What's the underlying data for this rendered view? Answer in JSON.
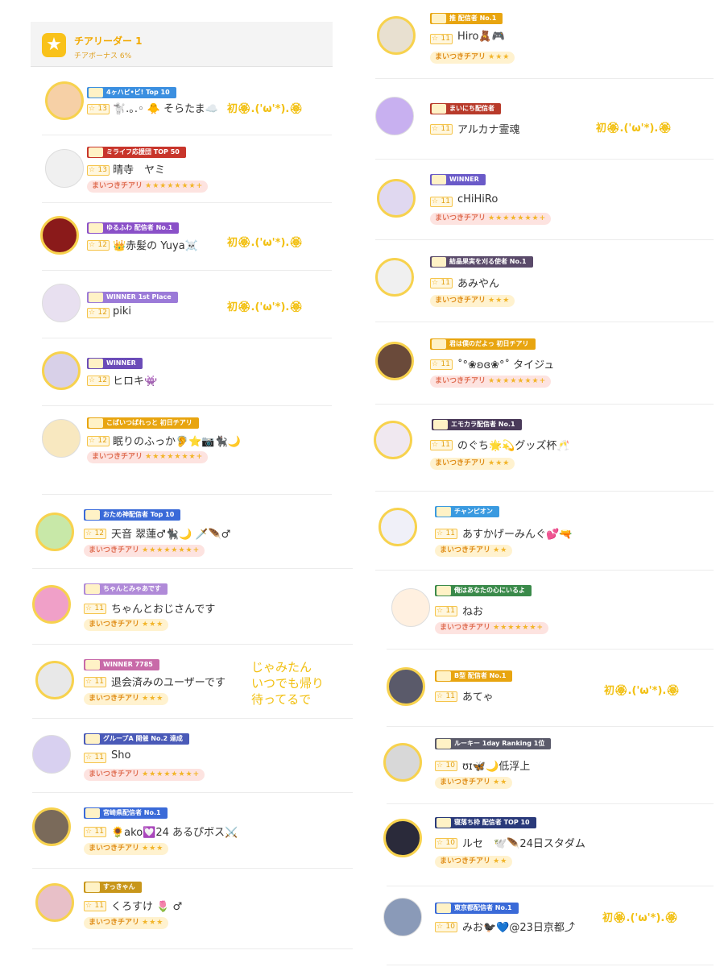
{
  "header": {
    "title": "チアリーダー 1",
    "subtitle": "チアボーナス 6%"
  },
  "badge_labels": {
    "maitsuki": "まいつきチアリ",
    "mainichi": "まいにち配信者",
    "winner": "WINNER"
  },
  "left_rows": [
    {
      "level": "13",
      "name": "🐩.｡.◦ 🐥 そらたま☁️",
      "ribbon": "4ヶハピ•ビ! Top 10",
      "ribbon_color": "#3b8fe0",
      "cheer": null,
      "comment": "初🏵.('ω'*).🏵"
    },
    {
      "level": "13",
      "name": "晴寺　ヤミ",
      "ribbon": "ミライフ応援団 TOP 50",
      "ribbon_color": "#c8352b",
      "cheer": "pink",
      "cheer_stars": "★★★★★★★+",
      "comment": null
    },
    {
      "level": "12",
      "name": "👑赤髪の Yuya☠️",
      "ribbon": "ゆるふわ 配信者 No.1",
      "ribbon_color": "#8a50c8",
      "cheer": null,
      "comment": "初🏵.('ω'*).🏵"
    },
    {
      "level": "12",
      "name": "piki",
      "ribbon": "WINNER 1st Place",
      "ribbon_color": "#9b7ad8",
      "cheer": null,
      "comment": "初🏵.('ω'*).🏵"
    },
    {
      "level": "12",
      "name": "ヒロキ👾",
      "ribbon": "WINNER",
      "ribbon_color": "#6b4cb8",
      "cheer": null,
      "comment": null
    },
    {
      "level": "12",
      "name": "眠りのふっか🦻⭐📷🐈‍⬛🌙",
      "ribbon": "こばいつばれっと 初日チアリ",
      "ribbon_color": "#e8a510",
      "cheer": "pink",
      "cheer_stars": "★★★★★★★+",
      "comment": null
    },
    {
      "level": "12",
      "name": "天音 翠蓮♂🐈‍⬛🌙 🗡️🪶♂",
      "ribbon": "おため神配信者 Top 10",
      "ribbon_color": "#3a6ad8",
      "cheer": "pink",
      "cheer_stars": "★★★★★★★+",
      "comment": null
    },
    {
      "level": "11",
      "name": "ちゃんとおじさんです",
      "ribbon": "ちゃんとみゃあです",
      "ribbon_color": "#b08ad8",
      "cheer": "yellow",
      "cheer_stars": "★★★",
      "comment": null
    },
    {
      "level": "11",
      "name": "退会済みのユーザーです",
      "ribbon": "WINNER 7785",
      "ribbon_color": "#c86aa8",
      "cheer": "yellow",
      "cheer_stars": "★★★",
      "comment": "じゃみたん\nいつでも帰り\n待ってるで"
    },
    {
      "level": "11",
      "name": "Sho",
      "ribbon": "グループA 開催 No.2 達成",
      "ribbon_color": "#4a5ab8",
      "cheer": "pink",
      "cheer_stars": "★★★★★★★+",
      "comment": null
    },
    {
      "level": "11",
      "name": "🌻ako💟24 あるぴボス⚔️",
      "ribbon": "宮崎県配信者 No.1",
      "ribbon_color": "#3a6ad8",
      "cheer": "yellow",
      "cheer_stars": "★★★",
      "comment": null
    },
    {
      "level": "11",
      "name": "くろすけ 🌷 ♂",
      "ribbon": "すっきゃん",
      "ribbon_color": "#c8961a",
      "cheer": "yellow",
      "cheer_stars": "★★★",
      "comment": null
    }
  ],
  "right_rows": [
    {
      "level": "11",
      "name": "Hiro🧸🎮",
      "ribbon": "推 配信者 No.1",
      "ribbon_color": "#e8a510",
      "cheer": "yellow",
      "cheer_stars": "★★★",
      "comment": null
    },
    {
      "level": "11",
      "name": "アルカナ霊魂",
      "ribbon": "まいにち配信者",
      "ribbon_color": "#b83a2a",
      "cheer": null,
      "comment": "初🏵.('ω'*).🏵"
    },
    {
      "level": "11",
      "name": "cHiHiRo",
      "ribbon": "WINNER",
      "ribbon_color": "#6a5ac8",
      "cheer": "pink",
      "cheer_stars": "★★★★★★★+",
      "comment": null
    },
    {
      "level": "11",
      "name": "あみやん",
      "ribbon": "結晶果実を刈る使者 No.1",
      "ribbon_color": "#5a4a6a",
      "cheer": "yellow",
      "cheer_stars": "★★★",
      "comment": null
    },
    {
      "level": "11",
      "name": "˚°❀ʚɞ❀°˚ タイジュ",
      "ribbon": "君は僕のだよっ 初日チアリ",
      "ribbon_color": "#e8a510",
      "cheer": "pink",
      "cheer_stars": "★★★★★★★+",
      "comment": null
    },
    {
      "level": "11",
      "name": "のぐち🌟💫グッズ杯🥂",
      "ribbon": "エモカラ配信者 No.1",
      "ribbon_color": "#4a3a5a",
      "cheer": "yellow",
      "cheer_stars": "★★★",
      "comment": null
    },
    {
      "level": "11",
      "name": "あすかげーみんぐ💕🔫",
      "ribbon": "チャンピオン",
      "ribbon_color": "#3a9ae0",
      "cheer": "yellow",
      "cheer_stars": "★★",
      "comment": null
    },
    {
      "level": "11",
      "name": "ねお",
      "ribbon": "俺はあなたの心にいるよ",
      "ribbon_color": "#3a8a4a",
      "cheer": "pink",
      "cheer_stars": "★★★★★★+",
      "comment": null
    },
    {
      "level": "11",
      "name": "あてゃ",
      "ribbon": "B型 配信者 No.1",
      "ribbon_color": "#e8a510",
      "cheer": null,
      "comment": "初🏵.('ω'*).🏵"
    },
    {
      "level": "10",
      "name": "ʊɪ🦋🌙低浮上",
      "ribbon": "ルーキー 1day Ranking 1位",
      "ribbon_color": "#5a5a6a",
      "cheer": "yellow",
      "cheer_stars": "★★",
      "comment": null
    },
    {
      "level": "10",
      "name": "ルセ　🕊️🪶24日スタダム",
      "ribbon": "寝落ち枠 配信者 TOP 10",
      "ribbon_color": "#2a3a7a",
      "cheer": "yellow",
      "cheer_stars": "★★",
      "comment": null
    },
    {
      "level": "10",
      "name": "みお🐦‍⬛💙@23日京都⤴︎",
      "ribbon": "東京都配信者 No.1",
      "ribbon_color": "#3a6ad8",
      "cheer": null,
      "comment": "初🏵.('ω'*).🏵"
    }
  ],
  "colors": {
    "accent": "#f9c21a",
    "cheer_pink_bg": "#fde3e0",
    "cheer_yellow_bg": "#fff2cf",
    "comment": "#f2c012"
  }
}
